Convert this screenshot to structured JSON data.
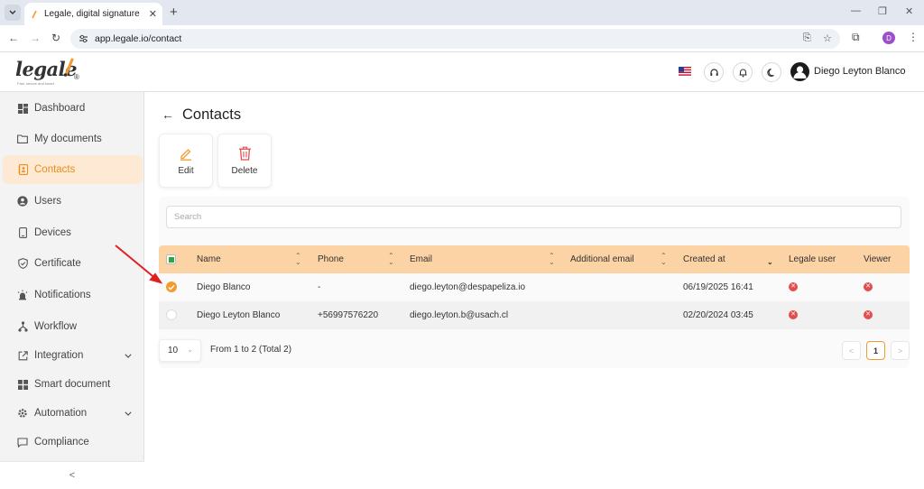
{
  "browser": {
    "tab_title": "Legale, digital signature",
    "url": "app.legale.io/contact",
    "profile_initial": "D"
  },
  "header": {
    "logo": "legale",
    "logo_mark": "®",
    "tagline": "Fast, secure and smart",
    "language": "en-US",
    "user_name": "Diego Leyton Blanco",
    "icons": [
      "us-flag-icon",
      "support-icon",
      "bell-icon",
      "theme-toggle-icon",
      "user-avatar"
    ]
  },
  "sidebar": {
    "items": [
      {
        "label": "Dashboard",
        "icon": "dashboard-icon"
      },
      {
        "label": "My documents",
        "icon": "folder-icon"
      },
      {
        "label": "Contacts",
        "icon": "contacts-icon",
        "active": true
      },
      {
        "label": "Users",
        "icon": "user-icon"
      },
      {
        "label": "Devices",
        "icon": "device-icon"
      },
      {
        "label": "Certificate",
        "icon": "shield-icon"
      },
      {
        "label": "Notifications",
        "icon": "alarm-icon"
      },
      {
        "label": "Workflow",
        "icon": "workflow-icon"
      },
      {
        "label": "Integration",
        "icon": "external-link-icon",
        "expandable": true
      },
      {
        "label": "Smart document",
        "icon": "grid-icon"
      },
      {
        "label": "Automation",
        "icon": "gear-icon",
        "expandable": true
      },
      {
        "label": "Compliance",
        "icon": "chat-icon"
      }
    ],
    "collapse_glyph": "<"
  },
  "main": {
    "title": "Contacts",
    "toolbar": {
      "edit_label": "Edit",
      "delete_label": "Delete"
    },
    "search": {
      "placeholder": "Search",
      "value": ""
    },
    "table": {
      "columns": [
        "Name",
        "Phone",
        "Email",
        "Additional email",
        "Created at",
        "Legale user",
        "Viewer"
      ],
      "rows": [
        {
          "selected": true,
          "name": "Diego Blanco",
          "phone": "-",
          "email": "diego.leyton@despapeliza.io",
          "additional_email": "",
          "created_at": "06/19/2025 16:41",
          "legale_user": false,
          "viewer": false
        },
        {
          "selected": false,
          "name": "Diego Leyton Blanco",
          "phone": "+56997576220",
          "email": "diego.leyton.b@usach.cl",
          "additional_email": "",
          "created_at": "02/20/2024 03:45",
          "legale_user": false,
          "viewer": false
        }
      ]
    },
    "pagination": {
      "page_size": "10",
      "range_text": "From 1 to 2 (Total 2)",
      "current_page": "1"
    }
  },
  "colors": {
    "accent": "#f39b2f",
    "header_row": "#fcd3a4",
    "active_nav": "#fde9d4",
    "delete": "#e34d4d",
    "annotation_arrow": "#e02020"
  }
}
